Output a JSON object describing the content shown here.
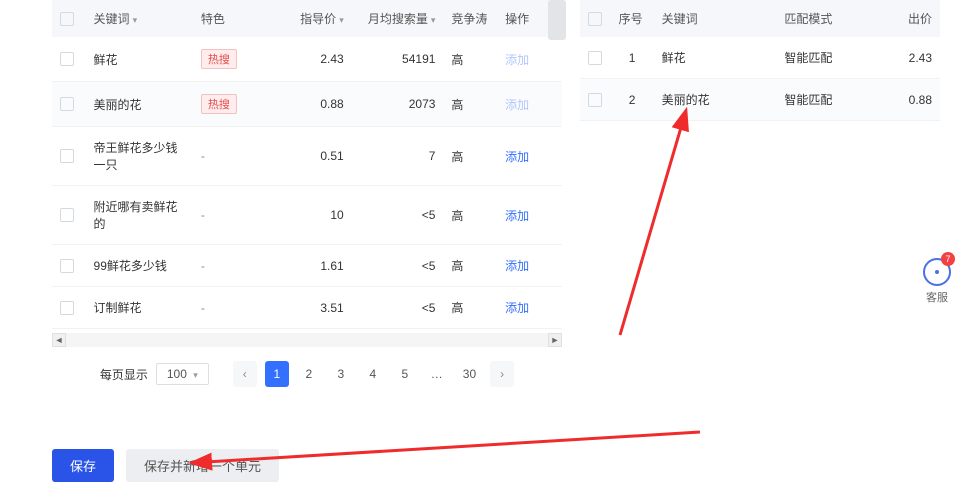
{
  "left": {
    "cols": {
      "keyword": "关键词",
      "feature": "特色",
      "price": "指导价",
      "volume": "月均搜索量",
      "comp_short": "竞争涛",
      "action": "操作"
    },
    "rows": [
      {
        "keyword": "鲜花",
        "feature": "hot",
        "price": "2.43",
        "volume": "54191",
        "comp": "高",
        "action": "添加",
        "added": true
      },
      {
        "keyword": "美丽的花",
        "feature": "hot",
        "price": "0.88",
        "volume": "2073",
        "comp": "高",
        "action": "添加",
        "added": true
      },
      {
        "keyword": "帝王鲜花多少钱一只",
        "feature": "-",
        "price": "0.51",
        "volume": "7",
        "comp": "高",
        "action": "添加",
        "added": false
      },
      {
        "keyword": "附近哪有卖鲜花的",
        "feature": "-",
        "price": "10",
        "volume": "<5",
        "comp": "高",
        "action": "添加",
        "added": false
      },
      {
        "keyword": "99鲜花多少钱",
        "feature": "-",
        "price": "1.61",
        "volume": "<5",
        "comp": "高",
        "action": "添加",
        "added": false
      },
      {
        "keyword": "订制鲜花",
        "feature": "-",
        "price": "3.51",
        "volume": "<5",
        "comp": "高",
        "action": "添加",
        "added": false
      }
    ],
    "hot_label": "热搜",
    "pager": {
      "perpage_label": "每页显示",
      "perpage_value": "100",
      "pages": [
        "1",
        "2",
        "3",
        "4",
        "5"
      ],
      "ellipsis": "…",
      "last": "30"
    }
  },
  "right": {
    "cols": {
      "seq": "序号",
      "keyword": "关键词",
      "match": "匹配模式",
      "bid": "出价"
    },
    "rows": [
      {
        "seq": "1",
        "keyword": "鲜花",
        "match": "智能匹配",
        "bid": "2.43"
      },
      {
        "seq": "2",
        "keyword": "美丽的花",
        "match": "智能匹配",
        "bid": "0.88"
      }
    ]
  },
  "footer": {
    "save": "保存",
    "save_new": "保存并新增一个单元"
  },
  "cs": {
    "label": "客服",
    "badge": "7"
  }
}
